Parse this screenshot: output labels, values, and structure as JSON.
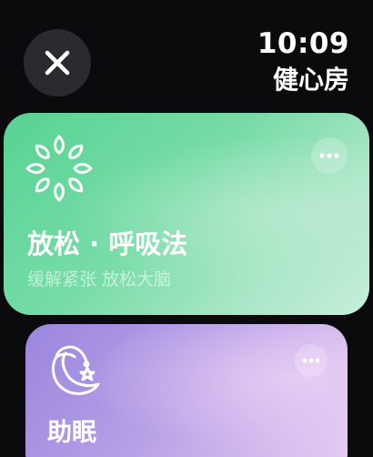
{
  "status": {
    "time": "10:09",
    "app_title": "健心房"
  },
  "close_button": {
    "icon": "close-icon"
  },
  "cards": [
    {
      "title": "放松 · 呼吸法",
      "subtitle": "缓解紧张 放松大脑",
      "icon": "leaf-wreath-icon",
      "more_icon": "more-dots-icon",
      "colors": {
        "start": "#57d392",
        "end": "#c7eedb"
      }
    },
    {
      "title": "助眠",
      "icon": "sleeping-moon-icon",
      "more_icon": "more-dots-icon",
      "colors": {
        "start": "#9a86dd",
        "end": "#e6cdf2"
      }
    }
  ]
}
